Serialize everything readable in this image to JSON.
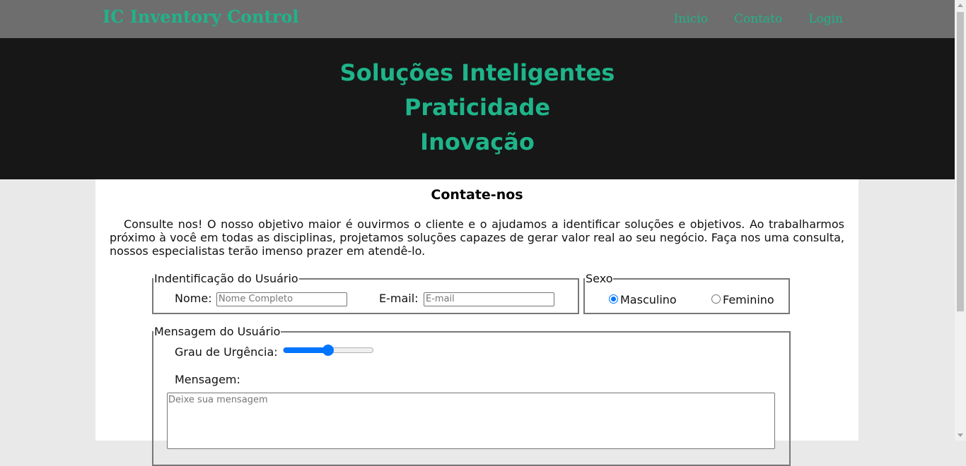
{
  "header": {
    "brand": "IC Inventory Control",
    "nav": [
      "Inicio",
      "Contato",
      "Login"
    ]
  },
  "hero": {
    "lines": [
      "Soluções Inteligentes",
      "Praticidade",
      "Inovação"
    ]
  },
  "main": {
    "title": "Contate-nos",
    "intro": "Consulte nos! O nosso objetivo maior é ouvirmos o cliente e o ajudamos a identificar soluções e objetivos. Ao trabalharmos próximo à você em todas as disciplinas, projetamos soluções capazes de gerar valor real ao seu negócio. Faça nos uma consulta, nossos especialistas terão imenso prazer em atendê-lo."
  },
  "form": {
    "identification": {
      "legend": "Indentificação do Usuário",
      "name_label": "Nome:",
      "name_placeholder": "Nome Completo",
      "email_label": "E-mail:",
      "email_placeholder": "E-mail"
    },
    "sex": {
      "legend": "Sexo",
      "options": [
        "Masculino",
        "Feminino"
      ],
      "selected": "Masculino"
    },
    "message": {
      "legend": "Mensagem do Usuário",
      "urgency_label": "Grau de Urgência:",
      "urgency_value": 0.5,
      "message_label": "Mensagem:",
      "message_placeholder": "Deixe sua mensagem"
    }
  },
  "colors": {
    "accent": "#1fb48a",
    "topbar": "#6e6e6e",
    "hero_bg": "#171717",
    "control_blue": "#0075ff"
  }
}
